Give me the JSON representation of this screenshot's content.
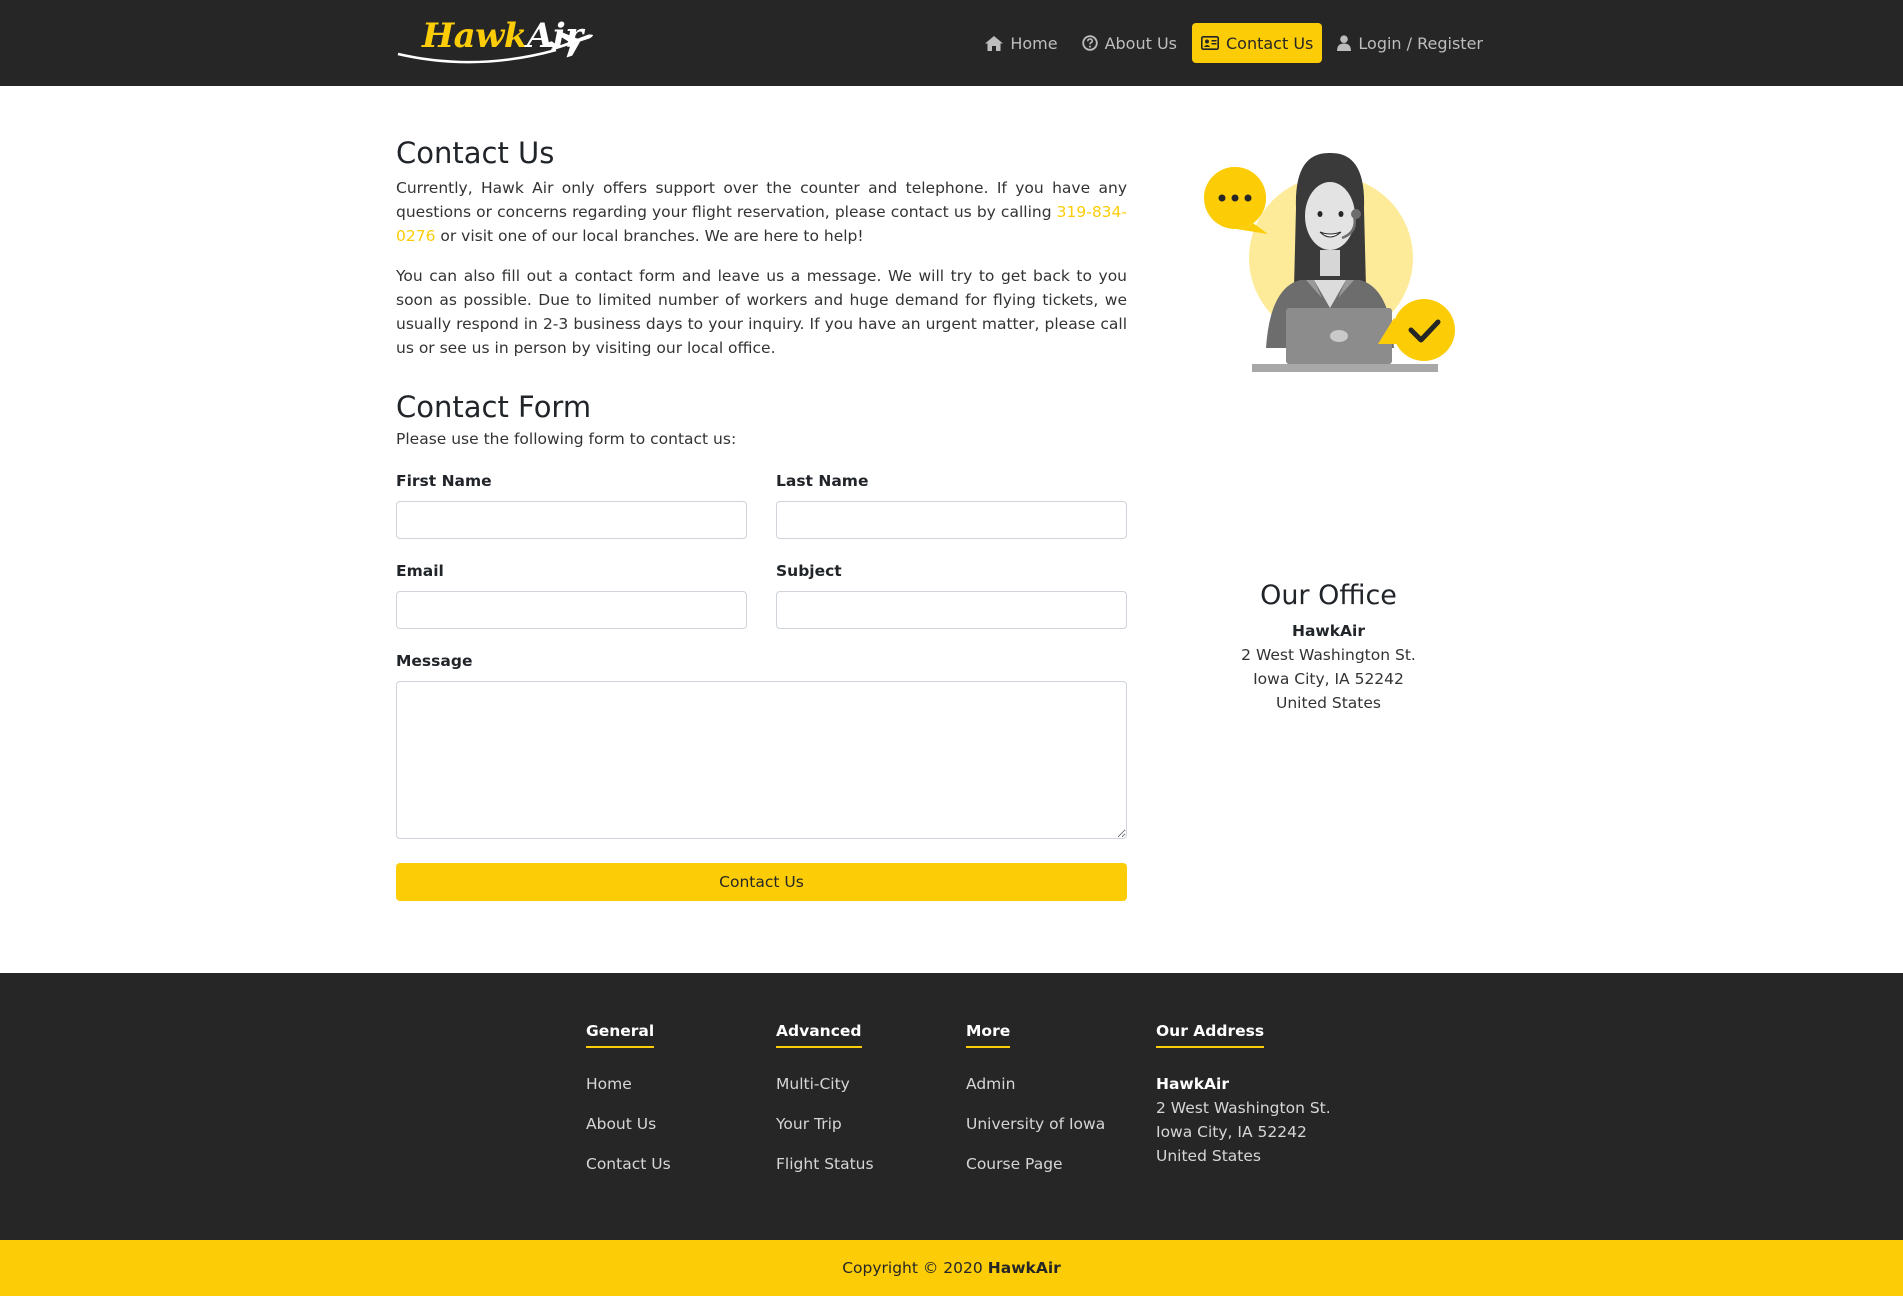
{
  "brand": {
    "logo_part1": "Hawk",
    "logo_part2": "Air"
  },
  "nav": {
    "home": "Home",
    "about": "About Us",
    "contact": "Contact Us",
    "login": "Login / Register"
  },
  "contact": {
    "title": "Contact Us",
    "p1_before": "Currently, Hawk Air only offers support over the counter and telephone. If you have any questions or concerns regarding your flight reservation, please contact us by calling ",
    "phone": "319-834-0276",
    "p1_after": " or visit one of our local branches. We are here to help!",
    "p2": "You can also fill out a contact form and leave us a message. We will try to get back to you soon as possible. Due to limited number of workers and huge demand for flying tickets, we usually respond in 2-3 business days to your inquiry. If you have an urgent matter, please call us or see us in person by visiting our local office."
  },
  "form": {
    "title": "Contact Form",
    "intro": "Please use the following form to contact us:",
    "first_name_label": "First Name",
    "last_name_label": "Last Name",
    "email_label": "Email",
    "subject_label": "Subject",
    "message_label": "Message",
    "first_name_value": "",
    "last_name_value": "",
    "email_value": "",
    "subject_value": "",
    "message_value": "",
    "submit_label": "Contact Us"
  },
  "office": {
    "title": "Our Office",
    "company": "HawkAir",
    "street": "2 West Washington St.",
    "city": "Iowa City, IA 52242",
    "country": "United States"
  },
  "footer": {
    "general": {
      "title": "General",
      "links": [
        "Home",
        "About Us",
        "Contact Us"
      ]
    },
    "advanced": {
      "title": "Advanced",
      "links": [
        "Multi-City",
        "Your Trip",
        "Flight Status"
      ]
    },
    "more": {
      "title": "More",
      "links": [
        "Admin",
        "University of Iowa",
        "Course Page"
      ]
    },
    "address": {
      "title": "Our Address",
      "company": "HawkAir",
      "street": "2 West Washington St.",
      "city": "Iowa City, IA 52242",
      "country": "United States"
    }
  },
  "copyright": {
    "text": "Copyright © 2020",
    "brand": "HawkAir"
  },
  "colors": {
    "accent": "#fccd07",
    "dark": "#262626",
    "text_muted": "#bdbdbd"
  }
}
